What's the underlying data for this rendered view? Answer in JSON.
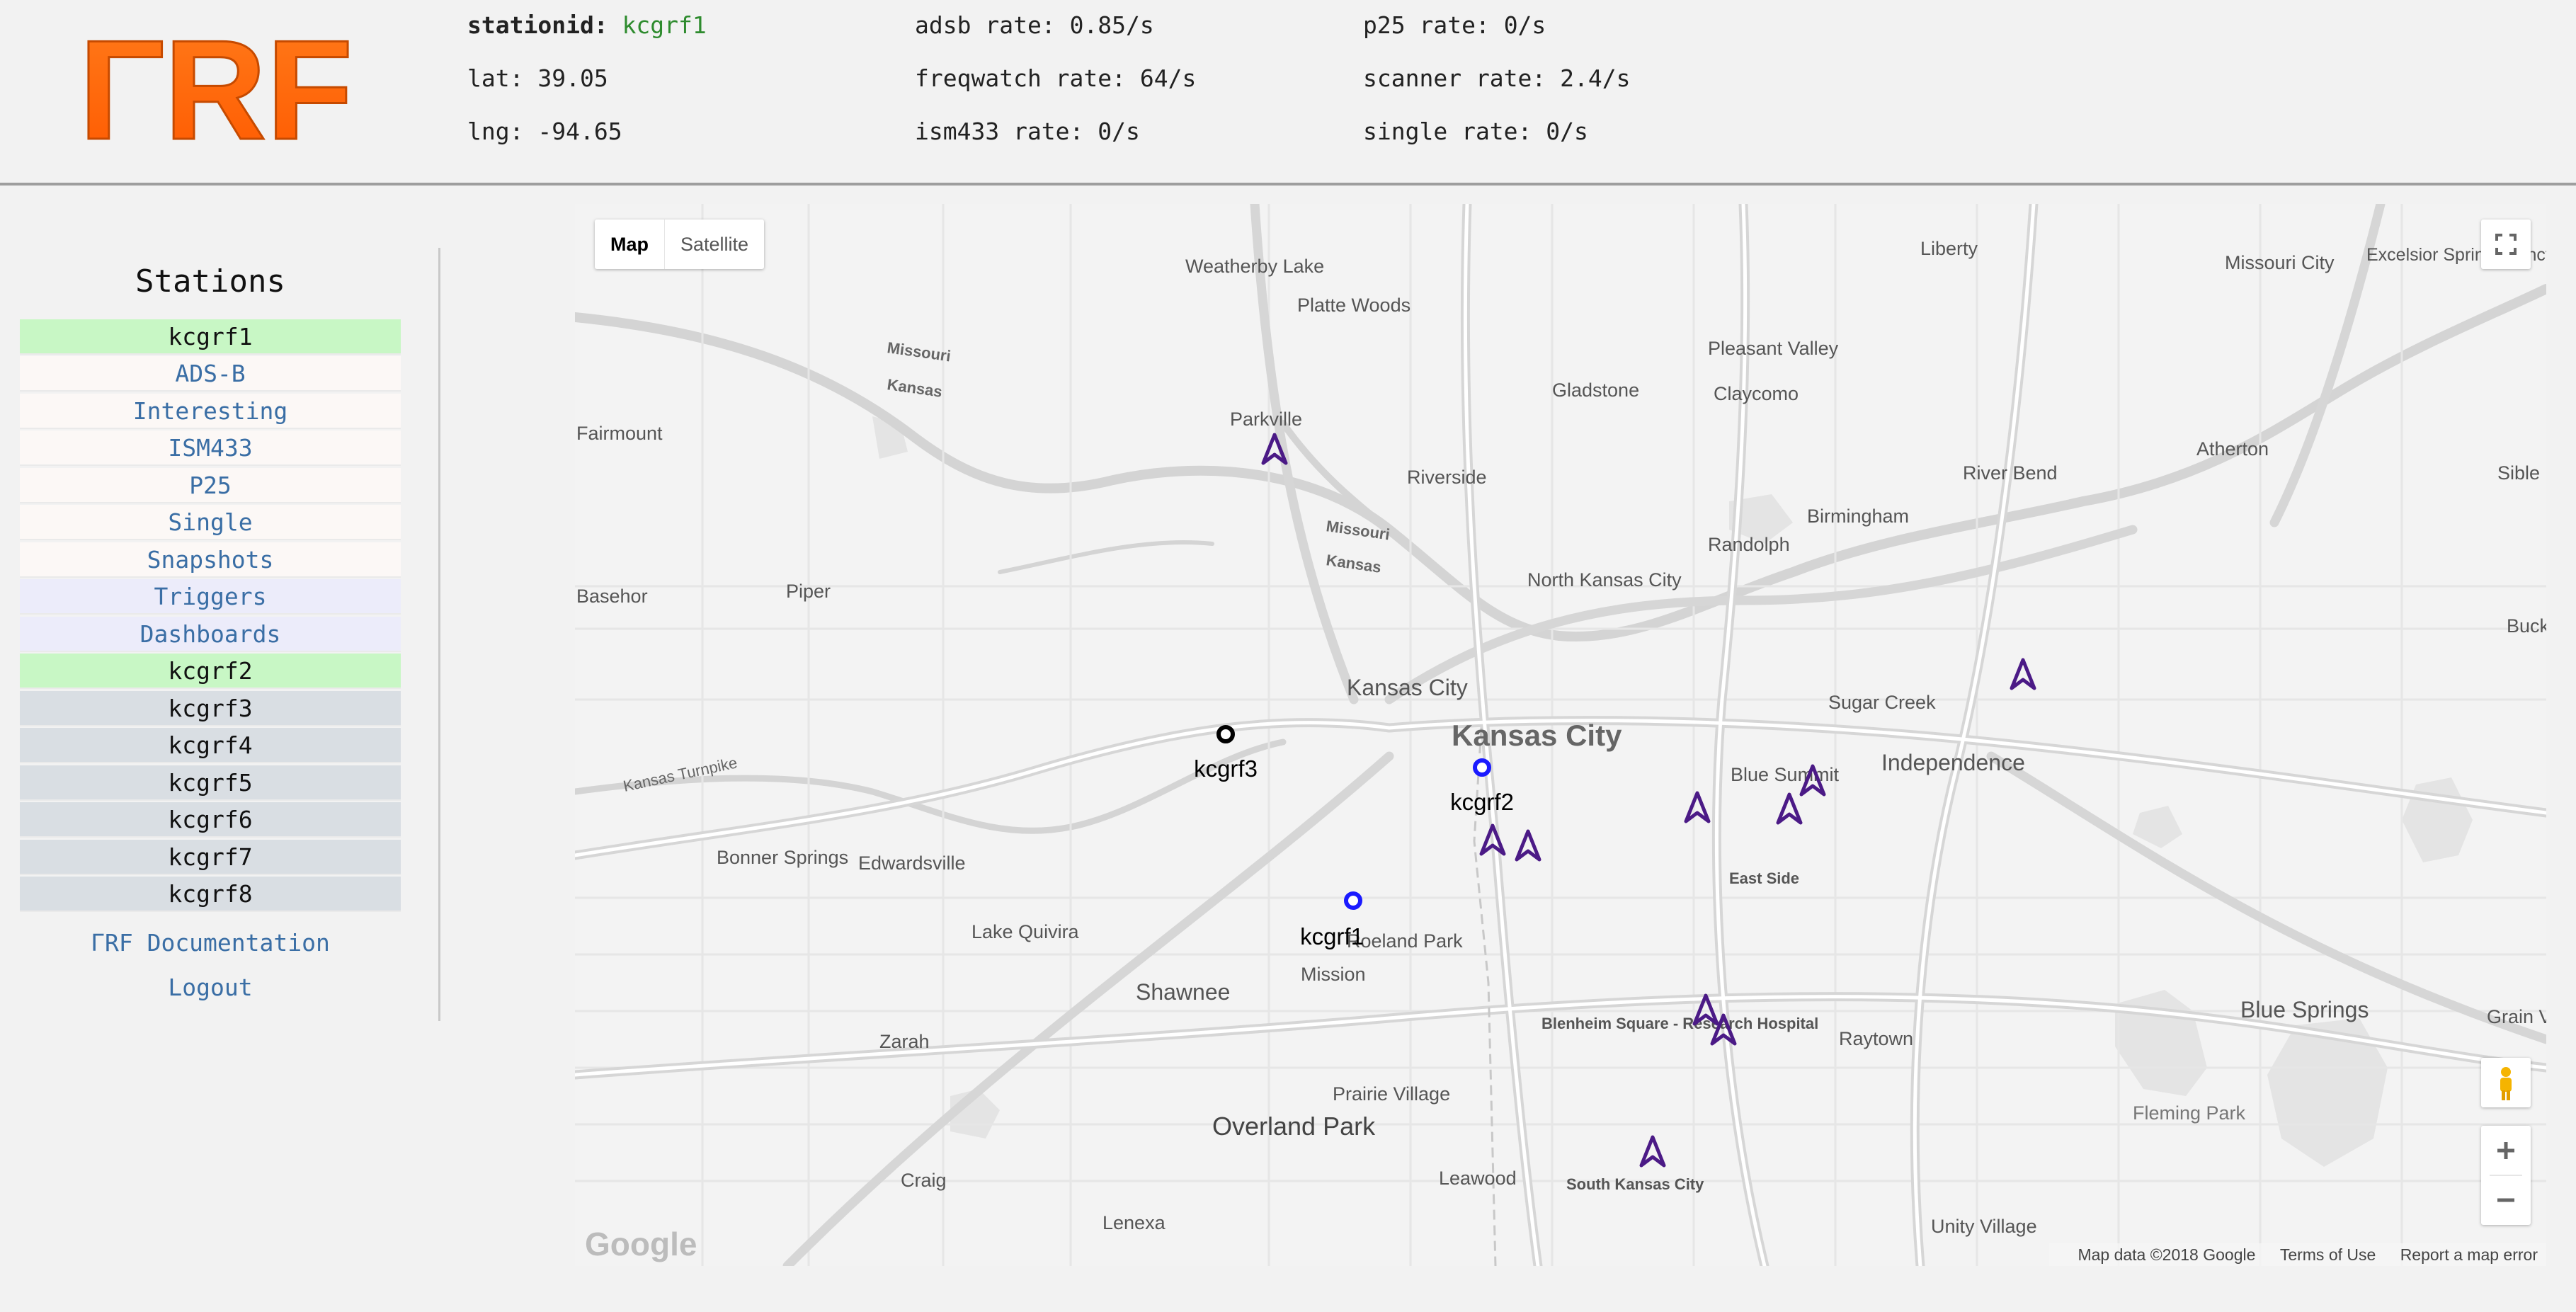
{
  "header": {
    "logo_text": "ΓRF",
    "stats": [
      {
        "key": "stationid:",
        "value": "kcgrf1"
      },
      {
        "key": "lat:",
        "value": "39.05"
      },
      {
        "key": "lng:",
        "value": "-94.65"
      },
      {
        "key": "adsb rate:",
        "value": "0.85/s"
      },
      {
        "key": "freqwatch rate:",
        "value": "64/s"
      },
      {
        "key": "ism433 rate:",
        "value": "0/s"
      },
      {
        "key": "p25 rate:",
        "value": "0/s"
      },
      {
        "key": "scanner rate:",
        "value": "2.4/s"
      },
      {
        "key": "single rate:",
        "value": "0/s"
      }
    ]
  },
  "sidebar": {
    "title": "Stations",
    "items": [
      {
        "label": "kcgrf1",
        "kind": "selected"
      },
      {
        "label": "ADS-B",
        "kind": "link"
      },
      {
        "label": "Interesting",
        "kind": "link"
      },
      {
        "label": "ISM433",
        "kind": "link"
      },
      {
        "label": "P25",
        "kind": "link"
      },
      {
        "label": "Single",
        "kind": "link"
      },
      {
        "label": "Snapshots",
        "kind": "link"
      },
      {
        "label": "Triggers",
        "kind": "config"
      },
      {
        "label": "Dashboards",
        "kind": "config"
      },
      {
        "label": "kcgrf2",
        "kind": "selected"
      },
      {
        "label": "kcgrf3",
        "kind": "station"
      },
      {
        "label": "kcgrf4",
        "kind": "station"
      },
      {
        "label": "kcgrf5",
        "kind": "station"
      },
      {
        "label": "kcgrf6",
        "kind": "station"
      },
      {
        "label": "kcgrf7",
        "kind": "station"
      },
      {
        "label": "kcgrf8",
        "kind": "station"
      }
    ],
    "documentation": "ΓRF Documentation",
    "logout": "Logout"
  },
  "map": {
    "map_type_map": "Map",
    "map_type_satellite": "Satellite",
    "attribution": "Map data ©2018 Google",
    "terms": "Terms of Use",
    "report": "Report a map error",
    "google_logo": "Google",
    "icons": {
      "fullscreen": "fullscreen-icon",
      "pegman": "pegman-icon",
      "zoom_in": "plus-icon",
      "zoom_out": "minus-icon",
      "aircraft": "aircraft-arrow-icon"
    },
    "colors": {
      "aircraft": "#4b1a86",
      "station_active": "#1a1aff",
      "station_other": "#000000",
      "road": "#dcdcdc",
      "major_road": "#ffffff"
    },
    "stations": [
      "kcgrf3",
      "kcgrf2",
      "kcgrf1"
    ],
    "places": [
      "Liberty",
      "Missouri City",
      "Excelsior Springs Junction",
      "Weatherby Lake",
      "Platte Woods",
      "Pleasant Valley",
      "Gladstone",
      "Claycomo",
      "Fairmount",
      "Parkville",
      "Atherton",
      "River Bend",
      "Sible",
      "Riverside",
      "Birmingham",
      "Randolph",
      "Basehor",
      "Piper",
      "North Kansas City",
      "Buckne",
      "Sugar Creek",
      "Kansas City",
      "Independence",
      "Blue Summit",
      "Bonner Springs",
      "Edwardsville",
      "East Side",
      "Lake Quivira",
      "Shawnee",
      "Mission",
      "Roeland Park",
      "Zarah",
      "Blue Springs",
      "Grain Val",
      "Raytown",
      "Blenheim Square - Research Hospital",
      "Fleming Park",
      "Prairie Village",
      "Overland Park",
      "Craig",
      "Leawood",
      "South Kansas City",
      "Lenexa",
      "Unity Village",
      "Kansas Turnpike",
      "Missouri",
      "Kansas"
    ]
  }
}
